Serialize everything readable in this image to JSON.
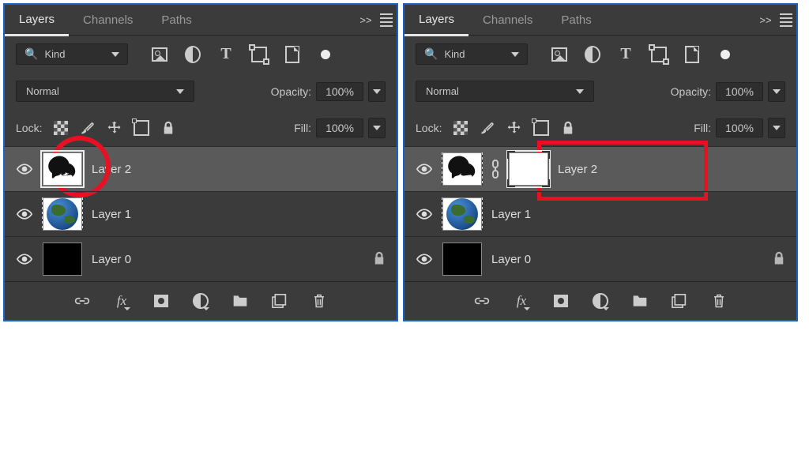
{
  "tabs": {
    "layers": "Layers",
    "channels": "Channels",
    "paths": "Paths",
    "expand": ">>"
  },
  "filter": {
    "kind": "Kind"
  },
  "blend": {
    "mode": "Normal",
    "opacity_label": "Opacity:",
    "opacity_val": "100%",
    "fill_label": "Fill:",
    "fill_val": "100%",
    "lock_label": "Lock:"
  },
  "layers_left": [
    {
      "name": "Layer 2",
      "selected": true,
      "thumb": "tree",
      "locked": false
    },
    {
      "name": "Layer 1",
      "selected": false,
      "thumb": "earth",
      "locked": false
    },
    {
      "name": "Layer 0",
      "selected": false,
      "thumb": "black",
      "locked": true
    }
  ],
  "layers_right": [
    {
      "name": "Layer 2",
      "selected": true,
      "thumb": "tree",
      "mask": true,
      "locked": false
    },
    {
      "name": "Layer 1",
      "selected": false,
      "thumb": "earth",
      "locked": false
    },
    {
      "name": "Layer 0",
      "selected": false,
      "thumb": "black",
      "locked": true
    }
  ],
  "fx": "fx"
}
